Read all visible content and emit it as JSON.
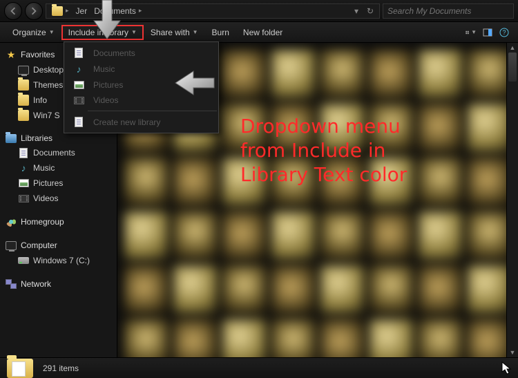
{
  "address": {
    "segments": [
      "Jer",
      "Documents"
    ],
    "hidden_segment_mask": ""
  },
  "search": {
    "placeholder": "Search My Documents"
  },
  "toolbar": {
    "organize": "Organize",
    "include": "Include in library",
    "share": "Share with",
    "burn": "Burn",
    "new_folder": "New folder"
  },
  "dropdown": {
    "items": [
      "Documents",
      "Music",
      "Pictures",
      "Videos"
    ],
    "create": "Create new library"
  },
  "sidebar": {
    "favorites": {
      "label": "Favorites",
      "items": [
        "Desktop",
        "Themes",
        "Info",
        "Win7 S"
      ]
    },
    "libraries": {
      "label": "Libraries",
      "items": [
        "Documents",
        "Music",
        "Pictures",
        "Videos"
      ]
    },
    "homegroup": "Homegroup",
    "computer": {
      "label": "Computer",
      "items": [
        "Windows 7 (C:)"
      ]
    },
    "network": "Network"
  },
  "status": {
    "count": "291 items"
  },
  "annotation": "Dropdown menu\nfrom Include in\nLibrary Text color"
}
